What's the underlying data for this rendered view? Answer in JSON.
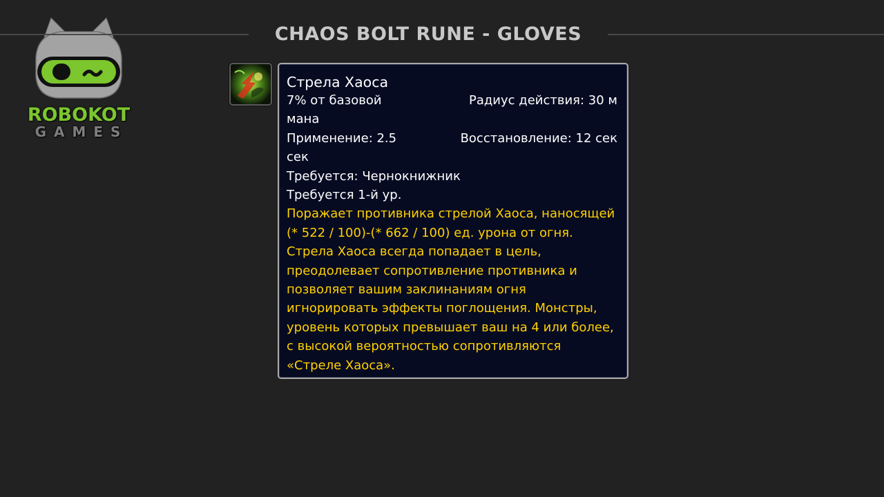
{
  "header": {
    "title": "CHAOS BOLT RUNE - GLOVES"
  },
  "logo": {
    "word1": "ROBOKOT",
    "word2": "GAMES",
    "colors": {
      "accent": "#7cc62e",
      "head": "#9a9a9a"
    }
  },
  "spell": {
    "icon": "chaos-bolt-icon",
    "tooltip": {
      "name": "Стрела Хаоса",
      "cost": "7% от базовой мана",
      "range": "Радиус действия: 30 м",
      "cast": "Применение: 2.5 сек",
      "cooldown": "Восстановление: 12 сек",
      "requires_class": "Требуется: Чернокнижник",
      "requires_level": "Требуется 1-й ур.",
      "description": "Поражает противника стрелой Хаоса, наносящей (* 522 / 100)-(* 662 / 100) ед. урона от огня. Стрела Хаоса всегда попадает в цель, преодолевает сопротивление противника и позволяет вашим заклинаниям огня игнорировать эффекты поглощения. Монстры, уровень которых превышает ваш на 4 или более, с высокой вероятностью сопротивляются «Стреле Хаоса»."
    }
  },
  "colors": {
    "background": "#222222",
    "tooltip_bg": "#070b22",
    "tooltip_border": "#a9a9a9",
    "description": "#ffd100"
  }
}
